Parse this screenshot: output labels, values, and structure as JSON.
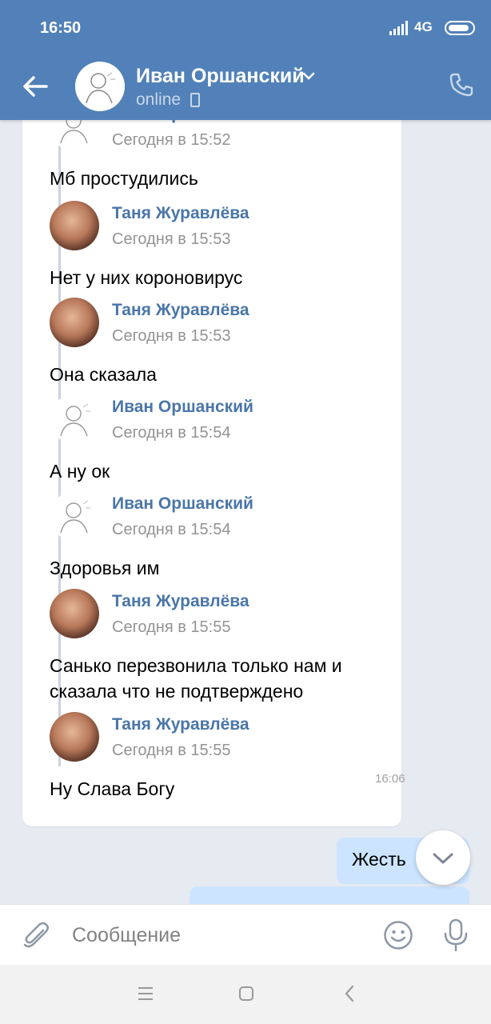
{
  "status_bar": {
    "time": "16:50",
    "network": "4G"
  },
  "header": {
    "name": "Иван Оршанский",
    "status": "online"
  },
  "forwarded": [
    {
      "author": "Иван Оршанский",
      "time": "Сегодня в 15:52",
      "text": "Мб простудились",
      "avatar": "ivan"
    },
    {
      "author": "Таня Журавлёва",
      "time": "Сегодня в 15:53",
      "text": "Нет у них короновирус",
      "avatar": "tanya"
    },
    {
      "author": "Таня Журавлёва",
      "time": "Сегодня в 15:53",
      "text": "Она сказала",
      "avatar": "tanya"
    },
    {
      "author": "Иван Оршанский",
      "time": "Сегодня в 15:54",
      "text": "А ну ок",
      "avatar": "ivan"
    },
    {
      "author": "Иван Оршанский",
      "time": "Сегодня в 15:54",
      "text": "Здоровья им",
      "avatar": "ivan"
    },
    {
      "author": "Таня Журавлёва",
      "time": "Сегодня в 15:55",
      "text": "Санько перезвонила только нам и сказала что не подтверждено",
      "avatar": "tanya"
    },
    {
      "author": "Таня Журавлёва",
      "time": "Сегодня в 15:55",
      "text": "Ну Слава Богу",
      "avatar": "tanya"
    }
  ],
  "bubble_time": "16:06",
  "outgoing": {
    "text": "Жесть"
  },
  "composer": {
    "placeholder": "Сообщение"
  },
  "colors": {
    "header": "#5181b8",
    "author": "#4a76a8",
    "outgoing_bubble": "#cce4ff"
  }
}
